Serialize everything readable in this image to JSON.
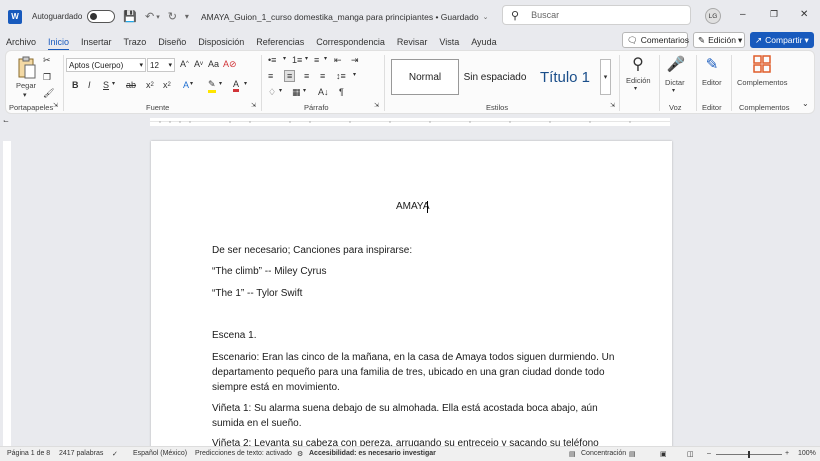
{
  "titlebar": {
    "app_icon": "W",
    "autosave_label": "Autoguardado",
    "doc_title": "AMAYA_Guion_1_curso domestika_manga para principiantes • Guardado",
    "search_placeholder": "Buscar",
    "avatar_initials": "LG"
  },
  "menu": {
    "items": [
      "Archivo",
      "Inicio",
      "Insertar",
      "Trazo",
      "Diseño",
      "Disposición",
      "Referencias",
      "Correspondencia",
      "Revisar",
      "Vista",
      "Ayuda"
    ],
    "comments": "Comentarios",
    "edit_mode": "Edición",
    "share": "Compartir"
  },
  "ribbon": {
    "paste_label": "Pegar",
    "clipboard_group": "Portapapeles",
    "font_name": "Aptos (Cuerpo)",
    "font_size": "12",
    "font_group": "Fuente",
    "paragraph_group": "Párrafo",
    "styles": [
      "Normal",
      "Sin espaciado",
      "Título 1"
    ],
    "styles_group": "Estilos",
    "edit_label": "Edición",
    "dictate_label": "Dictar",
    "voice_group": "Voz",
    "editor_label": "Editor",
    "editor_group": "Editor",
    "addins_label": "Complementos",
    "addins_group": "Complementos"
  },
  "document": {
    "title": "AMAYA",
    "lines": [
      "De ser necesario; Canciones para inspirarse:",
      "“The climb” -- Miley Cyrus",
      "“The 1” -- Tylor Swift",
      "Escena 1.",
      "Escenario: Eran las cinco de la mañana, en la casa de Amaya todos siguen durmiendo. Un",
      "departamento pequeño para una familia de tres, ubicado en una gran ciudad donde todo",
      "siempre está en movimiento.",
      " Viñeta 1: Su alarma suena debajo de su almohada. Ella está acostada boca abajo, aún",
      "sumida en el sueño.",
      "Viñeta 2: Levanta su cabeza con pereza, arrugando su entrecejo y sacando su teléfono"
    ]
  },
  "status": {
    "page": "Página 1 de 8",
    "words": "2417 palabras",
    "language": "Español (México)",
    "predictions": "Predicciones de texto: activado",
    "accessibility": "Accesibilidad: es necesario investigar",
    "focus": "Concentración",
    "zoom": "100%"
  },
  "colors": {
    "accent": "#185abd",
    "save_icon": "#7b2c8c",
    "font_color_bar": "#d13438",
    "highlight_bar": "#ffe600"
  }
}
